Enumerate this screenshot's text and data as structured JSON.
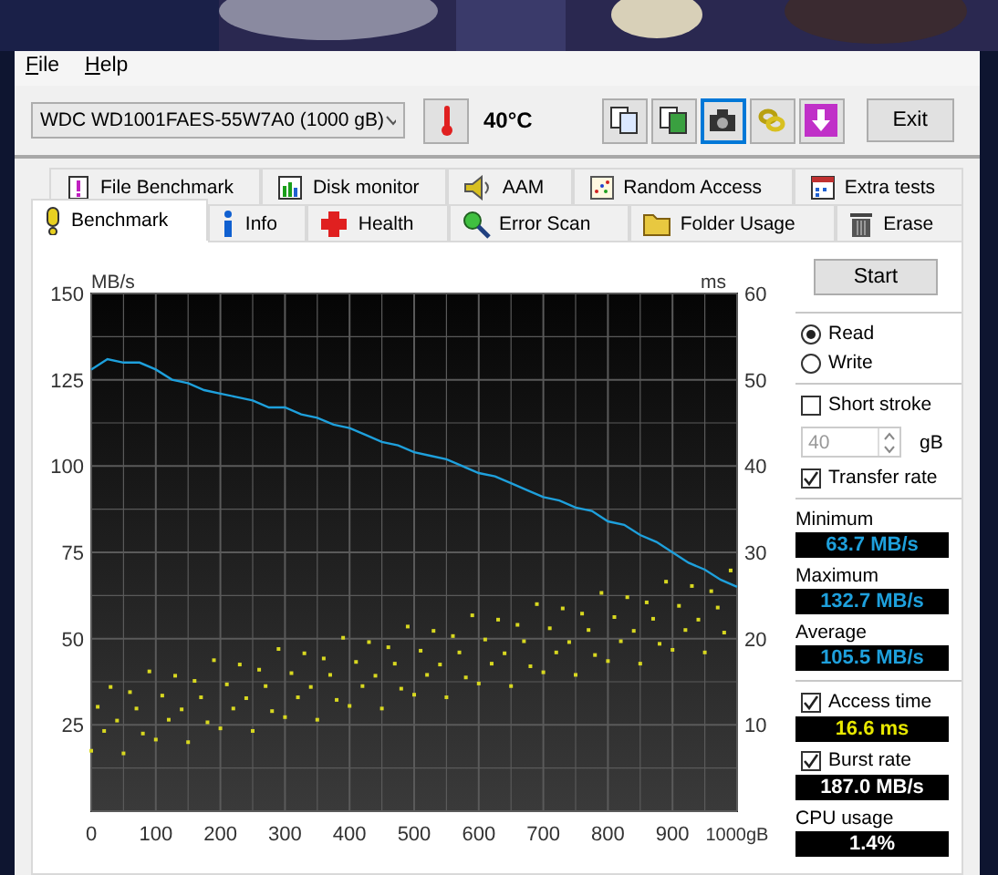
{
  "menu": [
    {
      "label": "File"
    },
    {
      "label": "Help"
    }
  ],
  "toolbar": {
    "drive": "WDC WD1001FAES-55W7A0 (1000 gB)",
    "temperature": "40°C",
    "icon_buttons": [
      {
        "selected": false
      },
      {
        "selected": false
      },
      {
        "selected": true
      },
      {
        "selected": false
      },
      {
        "selected": false
      }
    ],
    "exit": "Exit"
  },
  "tabs_top": [
    {
      "label": "File Benchmark",
      "selected": false
    },
    {
      "label": "Disk monitor",
      "selected": false
    },
    {
      "label": "AAM",
      "selected": false
    },
    {
      "label": "Random Access",
      "selected": false
    },
    {
      "label": "Extra tests",
      "selected": false
    }
  ],
  "tabs_bottom": [
    {
      "label": "Benchmark",
      "selected": true
    },
    {
      "label": "Info",
      "selected": false
    },
    {
      "label": "Health",
      "selected": false
    },
    {
      "label": "Error Scan",
      "selected": false
    },
    {
      "label": "Folder Usage",
      "selected": false
    },
    {
      "label": "Erase",
      "selected": false
    }
  ],
  "chart_data": {
    "type": "line",
    "ylabel": "MB/s",
    "y2label": "ms",
    "xlim": [
      0,
      1000
    ],
    "ylim": [
      0,
      150
    ],
    "xticks": [
      0,
      100,
      200,
      300,
      400,
      500,
      600,
      700,
      800,
      900,
      {
        "value": 1000,
        "label": "1000gB"
      }
    ],
    "yticks": [
      25,
      50,
      75,
      100,
      125,
      150
    ],
    "y2ticks": [
      10,
      20,
      30,
      40,
      50,
      60
    ],
    "y2lim": [
      0,
      60
    ],
    "grid": true,
    "x": [
      0,
      25,
      50,
      75,
      100,
      125,
      150,
      175,
      200,
      225,
      250,
      275,
      300,
      325,
      350,
      375,
      400,
      425,
      450,
      475,
      500,
      525,
      550,
      575,
      600,
      625,
      650,
      675,
      700,
      725,
      750,
      775,
      800,
      825,
      850,
      875,
      900,
      925,
      950,
      975,
      1000
    ],
    "series": [
      {
        "type": "scatter",
        "axis": "y2",
        "color": "#d8d820",
        "x": [
          0,
          10,
          20,
          30,
          40,
          50,
          60,
          70,
          80,
          90,
          100,
          110,
          120,
          130,
          140,
          150,
          160,
          170,
          180,
          190,
          200,
          210,
          220,
          230,
          240,
          250,
          260,
          270,
          280,
          290,
          300,
          310,
          320,
          330,
          340,
          350,
          360,
          370,
          380,
          390,
          400,
          410,
          420,
          430,
          440,
          450,
          460,
          470,
          480,
          490,
          500,
          510,
          520,
          530,
          540,
          550,
          560,
          570,
          580,
          590,
          600,
          610,
          620,
          630,
          640,
          650,
          660,
          670,
          680,
          690,
          700,
          710,
          720,
          730,
          740,
          750,
          760,
          770,
          780,
          790,
          800,
          810,
          820,
          830,
          840,
          850,
          860,
          870,
          880,
          890,
          900,
          910,
          920,
          930,
          940,
          950,
          960,
          970,
          980,
          990
        ],
        "values": [
          7,
          12.1,
          9.3,
          14.4,
          10.5,
          6.7,
          13.8,
          11.9,
          9,
          16.2,
          8.3,
          13.4,
          10.6,
          15.7,
          11.8,
          8,
          15.1,
          13.2,
          10.3,
          17.5,
          9.6,
          14.7,
          11.9,
          17,
          13.1,
          9.3,
          16.4,
          14.5,
          11.6,
          18.8,
          10.9,
          16,
          13.2,
          18.3,
          14.4,
          10.6,
          17.7,
          15.8,
          12.9,
          20.1,
          12.2,
          17.3,
          14.5,
          19.6,
          15.7,
          11.9,
          19,
          17.1,
          14.2,
          21.4,
          13.5,
          18.6,
          15.8,
          20.9,
          17,
          13.2,
          20.3,
          18.4,
          15.5,
          22.7,
          14.8,
          19.9,
          17.1,
          22.2,
          18.3,
          14.5,
          21.6,
          19.7,
          16.8,
          24,
          16.1,
          21.2,
          18.4,
          23.5,
          19.6,
          15.8,
          22.9,
          21,
          18.1,
          25.3,
          17.4,
          22.5,
          19.7,
          24.8,
          20.9,
          17.1,
          24.2,
          22.3,
          19.4,
          26.6,
          18.7,
          23.8,
          21,
          26.1,
          22.2,
          18.4,
          25.5,
          23.6,
          20.7,
          27.9
        ]
      },
      {
        "type": "line",
        "color": "#1ea0dc",
        "values": [
          128,
          131,
          130,
          130,
          128,
          125,
          124,
          122,
          121,
          120,
          119,
          117,
          117,
          115,
          114,
          112,
          111,
          109,
          107,
          106,
          104,
          103,
          102,
          100,
          98,
          97,
          95,
          93,
          91,
          90,
          88,
          87,
          84,
          83,
          80,
          78,
          75,
          72,
          70,
          67,
          65
        ]
      }
    ]
  },
  "controls": {
    "start": "Start",
    "modes": [
      {
        "label": "Read",
        "selected": true
      },
      {
        "label": "Write",
        "selected": false
      }
    ],
    "short_stroke": {
      "label": "Short stroke",
      "checked": false
    },
    "stroke_size": {
      "value": "40",
      "unit": "gB",
      "disabled": true
    },
    "transfer_rate": {
      "label": "Transfer rate",
      "checked": true
    },
    "readings": [
      {
        "label": "Minimum",
        "value": "63.7 MB/s",
        "kind": "rate"
      },
      {
        "label": "Maximum",
        "value": "132.7 MB/s",
        "kind": "rate"
      },
      {
        "label": "Average",
        "value": "105.5 MB/s",
        "kind": "rate"
      }
    ],
    "access_time": {
      "label": "Access time",
      "checked": true,
      "value": "16.6 ms",
      "kind": "time"
    },
    "burst_rate": {
      "label": "Burst rate",
      "checked": true,
      "value": "187.0 MB/s",
      "kind": "plain"
    },
    "cpu": {
      "label": "CPU usage",
      "value": "1.4%",
      "kind": "plain"
    }
  }
}
